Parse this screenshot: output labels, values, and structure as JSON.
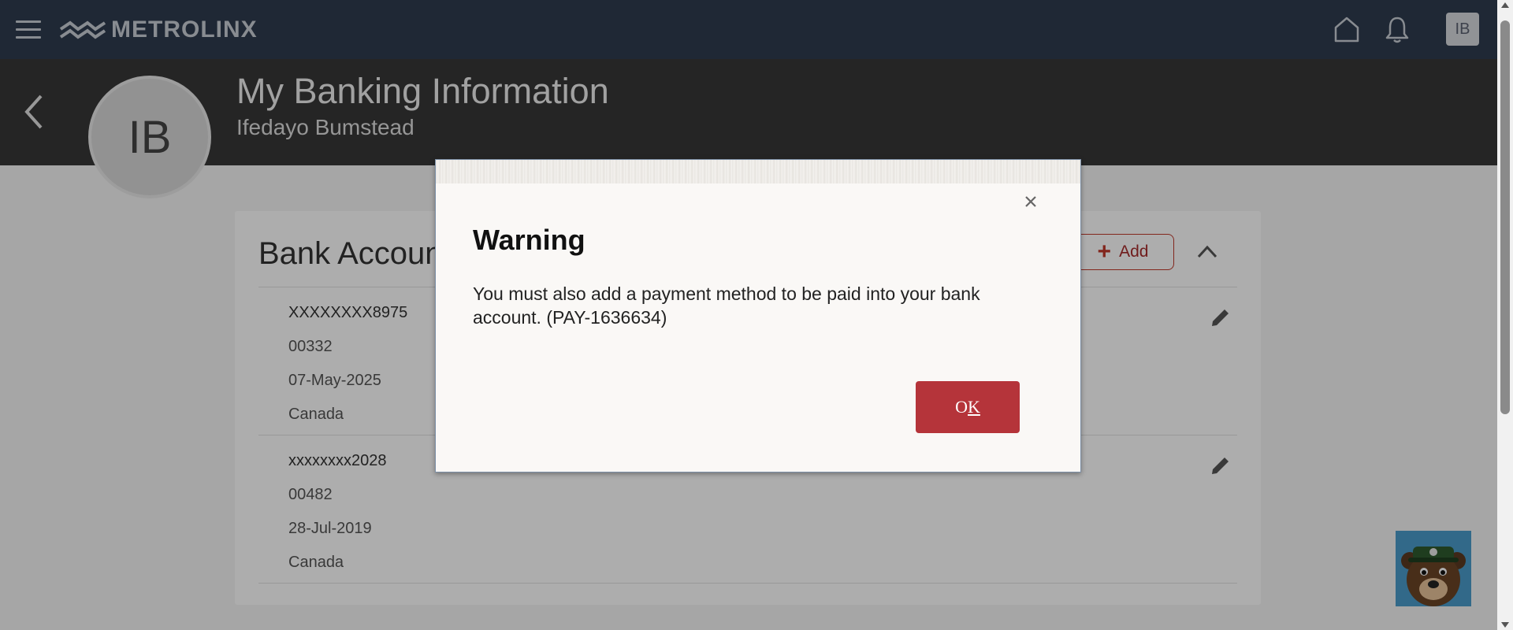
{
  "topbar": {
    "logo_text": "METROLINX",
    "avatar_initials": "IB",
    "icons": [
      "menu-icon",
      "home-icon",
      "bell-icon"
    ]
  },
  "header": {
    "title": "My Banking Information",
    "subtitle": "Ifedayo Bumstead",
    "avatar_initials": "IB"
  },
  "section": {
    "title": "Bank Account",
    "add_label": "Add"
  },
  "accounts": [
    {
      "number": "XXXXXXXX8975",
      "branch": "00332",
      "date": "07-May-2025",
      "country": "Canada"
    },
    {
      "number": "xxxxxxxx2028",
      "branch": "00482",
      "date": "28-Jul-2019",
      "country": "Canada"
    }
  ],
  "dialog": {
    "title": "Warning",
    "message": "You must also add a payment method to be paid into your bank account. (PAY-1636634)",
    "ok_prefix": "O",
    "ok_underlined": "K"
  },
  "colors": {
    "topbar": "#2f3b4e",
    "header": "#373737",
    "accent": "#b5343a"
  }
}
